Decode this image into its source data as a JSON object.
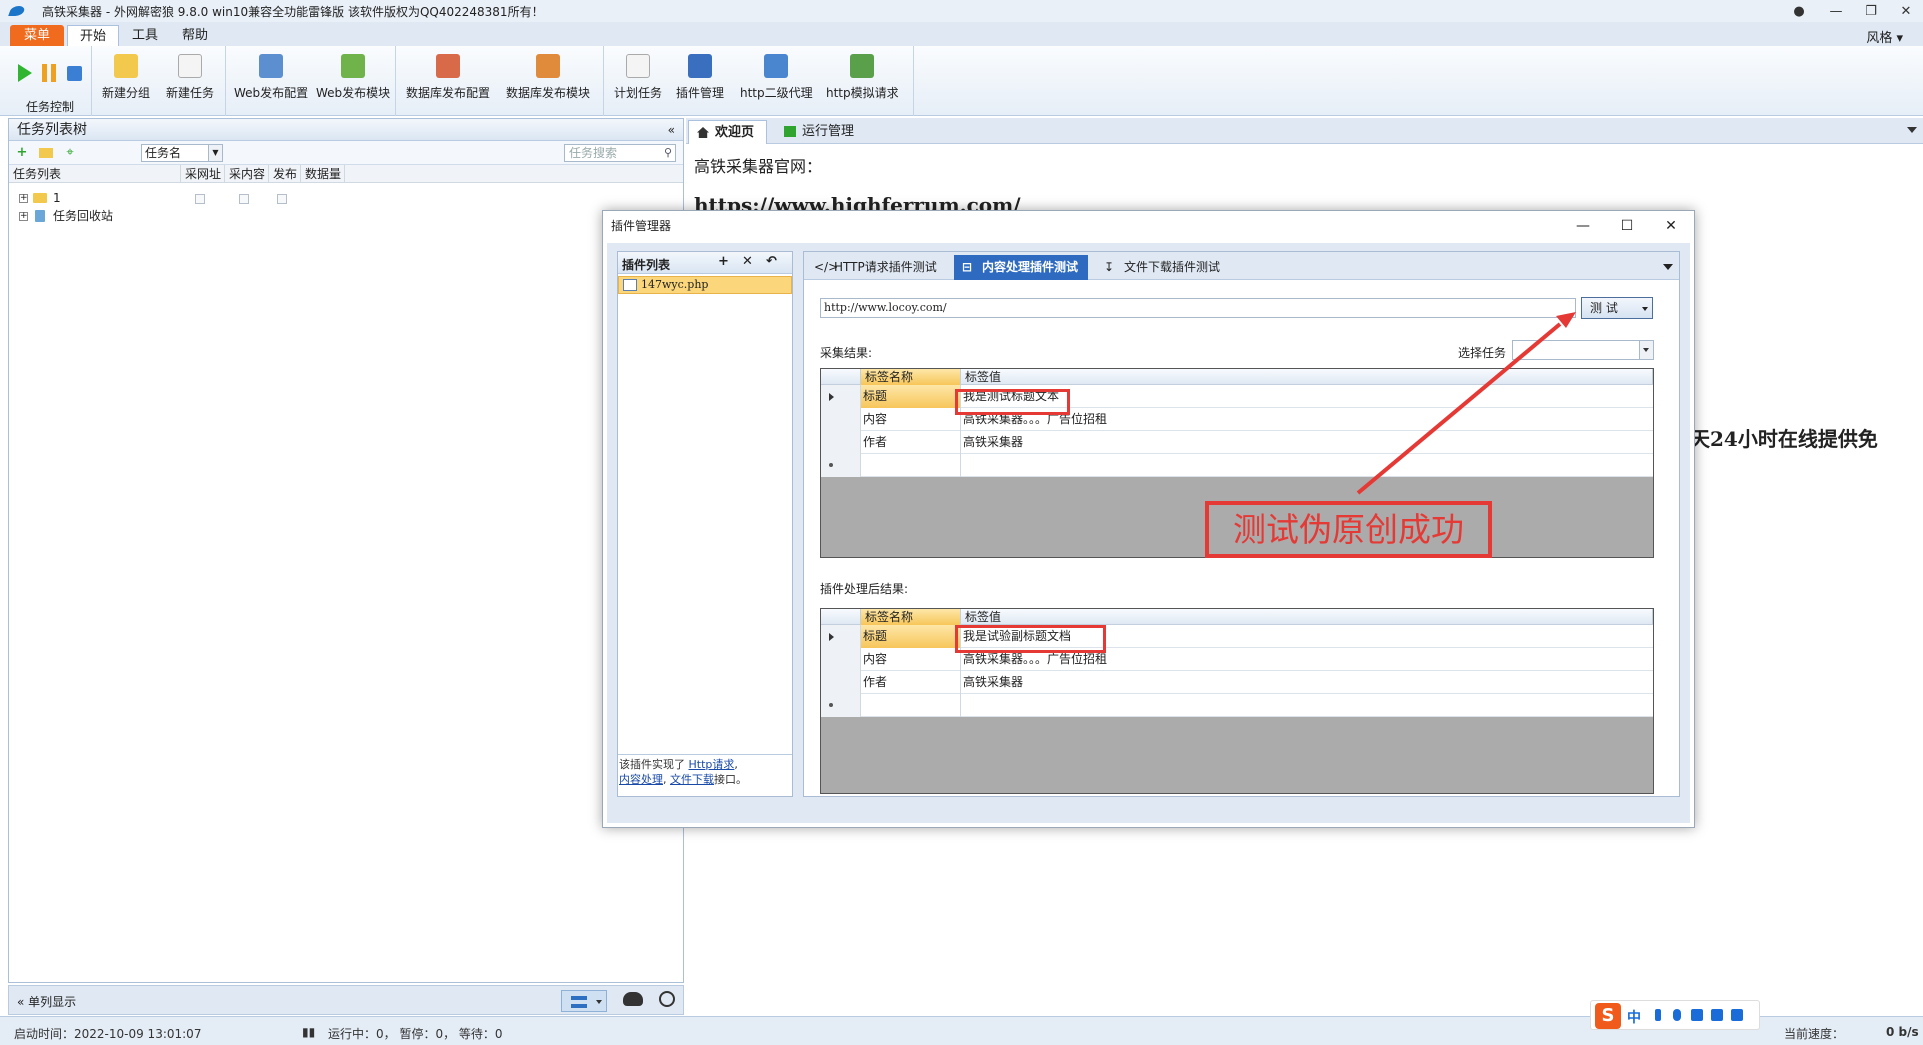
{
  "window": {
    "title": "高铁采集器 - 外网解密狼 9.8.0 win10兼容全功能雷锋版  该软件版权为QQ402248381所有！"
  },
  "ribbon_tabs": {
    "menu": "菜单",
    "start": "开始",
    "tools": "工具",
    "help": "帮助",
    "style": "风格"
  },
  "ribbon": {
    "task_control": "任务控制",
    "new_group": "新建分组",
    "new_task": "新建任务",
    "web_publish_config": "Web发布配置",
    "web_publish_module": "Web发布模块",
    "db_publish_config": "数据库发布配置",
    "db_publish_module": "数据库发布模块",
    "scheduled_task": "计划任务",
    "plugin_manager": "插件管理",
    "http_proxy": "http二级代理",
    "http_simulate": "http模拟请求"
  },
  "left_panel": {
    "title": "任务列表树",
    "collapse": "«",
    "taskname_select": "任务名",
    "search_placeholder": "任务搜索",
    "columns": [
      "任务列表",
      "采网址",
      "采内容",
      "发布",
      "数据量"
    ],
    "tree": [
      {
        "label": "1"
      },
      {
        "label": "任务回收站"
      }
    ],
    "footer_label": "单列显示"
  },
  "doc_tabs": {
    "welcome": "欢迎页",
    "run_manage": "运行管理"
  },
  "welcome": {
    "line1": "高铁采集器官网：",
    "line2": "https://www.highferrum.com/",
    "line3": "天24小时在线提供免"
  },
  "dialog": {
    "title": "插件管理器",
    "plugin_list_title": "插件列表",
    "plugin_item": "147wyc.php",
    "plugin_desc_prefix": "该插件实现了",
    "plugin_desc_link1": "Http请求",
    "plugin_desc_link2": "内容处理",
    "plugin_desc_link3": "文件下载",
    "plugin_desc_suffix": "接口。",
    "tabs": {
      "http": "HTTP请求插件测试",
      "content": "内容处理插件测试",
      "download": "文件下载插件测试"
    },
    "url_value": "http://www.locoy.com/",
    "test_button": "测 试",
    "collect_result_label": "采集结果:",
    "select_task_label": "选择任务",
    "after_result_label": "插件处理后结果:",
    "grid_headers": {
      "name": "标签名称",
      "value": "标签值"
    },
    "before_rows": [
      {
        "name": "标题",
        "value": "我是测试标题文本"
      },
      {
        "name": "内容",
        "value": "高铁采集器。。。广告位招租"
      },
      {
        "name": "作者",
        "value": "高铁采集器"
      }
    ],
    "after_rows": [
      {
        "name": "标题",
        "value": "我是试验副标题文档"
      },
      {
        "name": "内容",
        "value": "高铁采集器。。。广告位招租"
      },
      {
        "name": "作者",
        "value": "高铁采集器"
      }
    ]
  },
  "annotation": {
    "callout": "测试伪原创成功",
    "color": "#e53935"
  },
  "statusbar": {
    "start_time": "启动时间：2022-10-09 13:01:07",
    "running": "运行中：0，  暂停：0，  等待：0",
    "speed_label": "当前速度：",
    "speed_value": "0 b/s"
  },
  "ime": {
    "logo": "S",
    "mode": "中"
  }
}
